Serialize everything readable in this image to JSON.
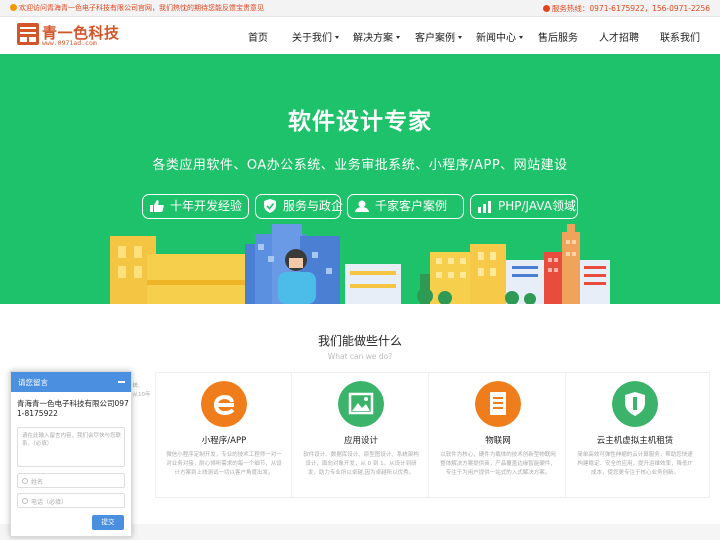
{
  "topbar": {
    "welcome": "欢迎访问青海青一色电子科技有限公司官网，我们热忱的期待您能反馈宝贵意见",
    "hotline": "服务热线：0971-6175922，156-0971-2256"
  },
  "logo": {
    "name": "青一色科技",
    "url": "www.0971ad.com",
    "mark_text": "青一色"
  },
  "nav": {
    "items": [
      {
        "label": "首页",
        "dropdown": false
      },
      {
        "label": "关于我们",
        "dropdown": true
      },
      {
        "label": "解决方案",
        "dropdown": true
      },
      {
        "label": "客户案例",
        "dropdown": true
      },
      {
        "label": "新闻中心",
        "dropdown": true
      },
      {
        "label": "售后服务",
        "dropdown": false
      },
      {
        "label": "人才招聘",
        "dropdown": false
      },
      {
        "label": "联系我们",
        "dropdown": false
      }
    ]
  },
  "hero": {
    "title": "软件设计专家",
    "subtitle": "各类应用软件、OA办公系统、业务审批系统、小程序/APP、网站建设",
    "tags": [
      {
        "label": "十年开发经验",
        "icon": "thumbs-up-icon"
      },
      {
        "label": "服务与政企",
        "icon": "shield-check-icon"
      },
      {
        "label": "千家客户案例",
        "icon": "user-group-icon"
      },
      {
        "label": "PHP/JAVA领域",
        "icon": "bar-chart-icon"
      }
    ],
    "bg_color": "#1ec26a"
  },
  "services": {
    "title": "我们能做些什么",
    "subtitle": "What can we do?",
    "stub_text": [
      "系统、",
      "、从10年"
    ],
    "cards": [
      {
        "title": "小程序/APP",
        "icon": "edge-e-icon",
        "color": "#f07d1b",
        "desc": "微信小程序定制开发，专业的技术工程师一对一对业务对接，耐心倾听需求的每一个细节，从设计方案到上线测试一切以客户角度出发。"
      },
      {
        "title": "应用设计",
        "icon": "image-icon",
        "color": "#3bb36a",
        "desc": "软件设计、数据库设计、原型图设计、系统架构设计，面向对象开发，从 0 到 1，从设计到研发，助力专业所以卓越,因为卓越所以优秀。"
      },
      {
        "title": "物联网",
        "icon": "document-icon",
        "color": "#f07d1b",
        "desc": "以软件为核心，硬件为载体的技术创新型物联网整体解决方案提供商，产品覆盖边缘智能硬件，专注于为用户提供一站式的入式解决方案。"
      },
      {
        "title": "云主机虚拟主机租赁",
        "icon": "shield-icon",
        "color": "#3bb36a",
        "desc": "简单高效可弹性伸缩的云计算服务，帮助您快速构建稳定、安全的应用，提升运维效率，降低IT成本，使您更专注于核心业务创新。"
      }
    ]
  },
  "message_widget": {
    "title": "请您留言",
    "company": "青海青一色电子科技有限公司0971-8175922",
    "textarea_placeholder": "请在此输入留言内容，我们会尽快与您联系。（必填）",
    "name_placeholder": "姓名",
    "phone_placeholder": "电话（必填）",
    "submit_label": "提交"
  }
}
